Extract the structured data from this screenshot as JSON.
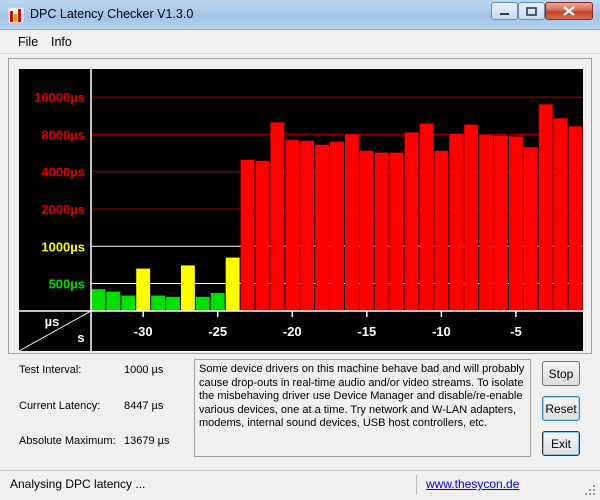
{
  "window": {
    "title": "DPC Latency Checker V1.3.0"
  },
  "menu": {
    "items": [
      "File",
      "Info"
    ]
  },
  "chart_data": {
    "type": "bar",
    "y_scale": "log2",
    "y_tick_labels": [
      "16000µs",
      "8000µs",
      "4000µs",
      "2000µs",
      "1000µs",
      "500µs"
    ],
    "y_tick_values": [
      16000,
      8000,
      4000,
      2000,
      1000,
      500
    ],
    "y_tick_colors": [
      "#e00000",
      "#e00000",
      "#e00000",
      "#e00000",
      "#ffff00",
      "#00e000"
    ],
    "x_tick_labels": [
      "-30",
      "-25",
      "-20",
      "-15",
      "-10",
      "-5"
    ],
    "x_tick_values": [
      -30,
      -25,
      -20,
      -15,
      -10,
      -5
    ],
    "corner_labels": {
      "unit_y": "µs",
      "unit_x": "s"
    },
    "x": [
      -33,
      -32,
      -31,
      -30,
      -29,
      -28,
      -27,
      -26,
      -25,
      -24,
      -23,
      -22,
      -21,
      -20,
      -19,
      -18,
      -17,
      -16,
      -15,
      -14,
      -13,
      -12,
      -11,
      -10,
      -9,
      -8,
      -7,
      -6,
      -5,
      -4,
      -3,
      -2,
      -1
    ],
    "values": [
      450,
      430,
      400,
      660,
      400,
      390,
      700,
      390,
      420,
      810,
      5000,
      4900,
      10000,
      7200,
      7100,
      6600,
      7000,
      8000,
      5900,
      5700,
      5700,
      8300,
      9800,
      5900,
      8100,
      9600,
      7900,
      7800,
      7700,
      6300,
      14000,
      10800,
      9300
    ],
    "thresholds": {
      "green_max": 500,
      "yellow_max": 1000
    },
    "colors": {
      "green": "#00e000",
      "yellow": "#ffff00",
      "red": "#ff0000",
      "background": "#000000",
      "grid": "#b00000",
      "grid_ok": "#ffffff"
    },
    "ylim": [
      300,
      27000
    ],
    "xlim": [
      -33.5,
      -0.5
    ]
  },
  "info": {
    "test_interval_label": "Test Interval:",
    "test_interval_value": "1000 µs",
    "current_latency_label": "Current Latency:",
    "current_latency_value": "8447 µs",
    "absolute_max_label": "Absolute Maximum:",
    "absolute_max_value": "13679 µs"
  },
  "description": "Some device drivers on this machine behave bad and will probably cause drop-outs in real-time audio and/or video streams. To isolate the misbehaving driver use Device Manager and disable/re-enable various devices, one at a time. Try network and W-LAN adapters, modems, internal sound devices, USB host controllers, etc.",
  "buttons": {
    "stop": "Stop",
    "reset": "Reset",
    "exit": "Exit"
  },
  "status": {
    "text": "Analysing DPC latency ...",
    "link": "www.thesycon.de"
  }
}
